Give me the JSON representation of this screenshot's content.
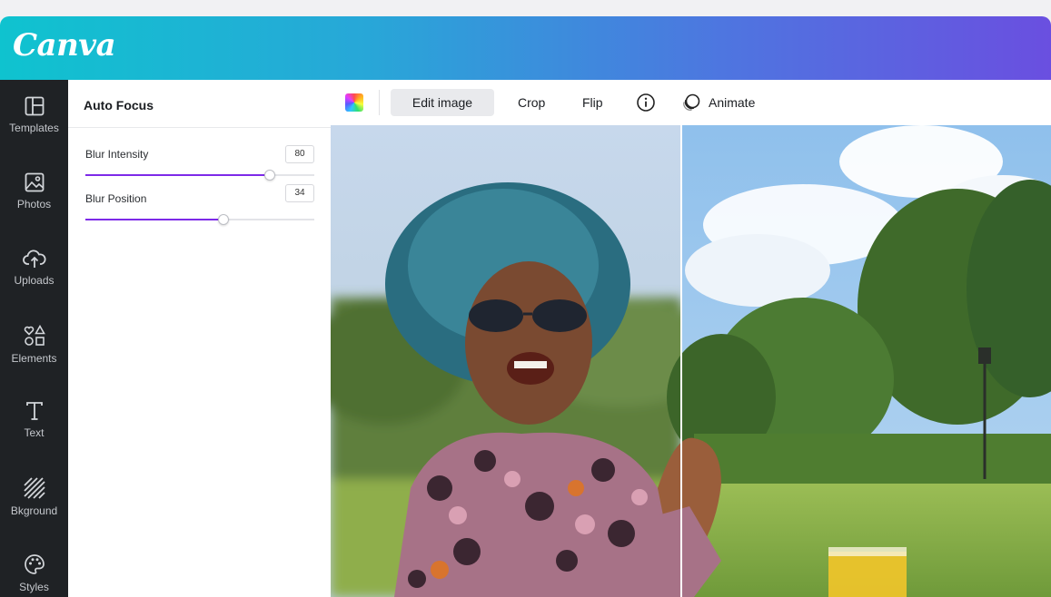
{
  "app": {
    "logo_text": "Canva"
  },
  "rail": {
    "items": [
      {
        "label": "Templates",
        "icon": "templates-icon"
      },
      {
        "label": "Photos",
        "icon": "photos-icon"
      },
      {
        "label": "Uploads",
        "icon": "upload-cloud-icon"
      },
      {
        "label": "Elements",
        "icon": "elements-icon"
      },
      {
        "label": "Text",
        "icon": "text-icon"
      },
      {
        "label": "Bkground",
        "icon": "background-pattern-icon"
      },
      {
        "label": "Styles",
        "icon": "palette-icon"
      }
    ]
  },
  "panel": {
    "title": "Auto Focus",
    "controls": [
      {
        "label": "Blur Intensity",
        "value": "80",
        "level_percent": 80
      },
      {
        "label": "Blur Position",
        "value": "34",
        "level_percent": 60
      }
    ]
  },
  "toolbar": {
    "edit_image": "Edit image",
    "crop": "Crop",
    "flip": "Flip",
    "info_icon": "info-icon",
    "animate": "Animate",
    "animate_icon": "animate-icon",
    "color_icon": "color-picker-icon"
  },
  "colors": {
    "accent": "#7d2ae8",
    "rail_bg": "#1f2225",
    "header_start": "#0fc3cf",
    "header_end": "#6a4fe0"
  }
}
